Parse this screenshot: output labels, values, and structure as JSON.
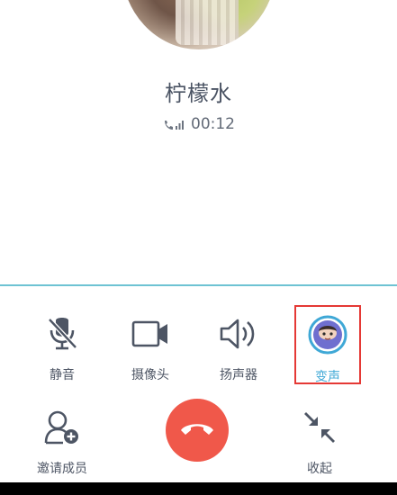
{
  "contact": {
    "name": "柠檬水",
    "duration": "00:12"
  },
  "controls_row1": [
    {
      "label": "静音",
      "icon": "mic-off-icon"
    },
    {
      "label": "摄像头",
      "icon": "camera-icon"
    },
    {
      "label": "扬声器",
      "icon": "speaker-icon"
    },
    {
      "label": "变声",
      "icon": "voice-changer-icon",
      "active": true
    }
  ],
  "controls_row2": [
    {
      "label": "邀请成员",
      "icon": "add-user-icon"
    },
    {
      "label": "",
      "icon": "hangup-icon"
    },
    {
      "label": "收起",
      "icon": "collapse-icon"
    }
  ],
  "colors": {
    "accent": "#3fa8d6",
    "divider": "#6ec3d3",
    "hangup": "#f0584a",
    "highlight": "#e53935"
  }
}
